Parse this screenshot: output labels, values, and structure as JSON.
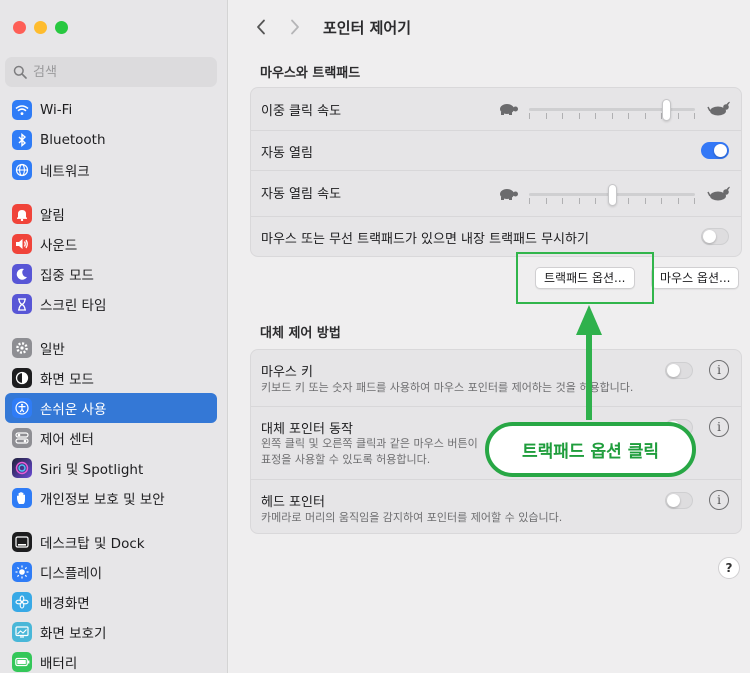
{
  "window": {
    "title": "포인터 제어기"
  },
  "sidebar": {
    "search_placeholder": "검색",
    "items": [
      {
        "label": "Wi-Fi",
        "icon": "wifi-icon",
        "color": "#2f7cf6"
      },
      {
        "label": "Bluetooth",
        "icon": "bluetooth-icon",
        "color": "#2f7cf6"
      },
      {
        "label": "네트워크",
        "icon": "globe-icon",
        "color": "#2f7cf6"
      },
      {
        "label": "알림",
        "icon": "bell-icon",
        "color": "#f0443a"
      },
      {
        "label": "사운드",
        "icon": "speaker-icon",
        "color": "#f0443a"
      },
      {
        "label": "집중 모드",
        "icon": "moon-icon",
        "color": "#5856d6"
      },
      {
        "label": "스크린 타임",
        "icon": "hourglass-icon",
        "color": "#5856d6"
      },
      {
        "label": "일반",
        "icon": "gear-icon",
        "color": "#8e8e93"
      },
      {
        "label": "화면 모드",
        "icon": "appearance-icon",
        "color": "#1d1d1f"
      },
      {
        "label": "손쉬운 사용",
        "icon": "accessibility-icon",
        "color": "#2f7cf6"
      },
      {
        "label": "제어 센터",
        "icon": "control-center-icon",
        "color": "#8e8e93"
      },
      {
        "label": "Siri 및 Spotlight",
        "icon": "siri-icon",
        "color": "#6b4bd6"
      },
      {
        "label": "개인정보 보호 및 보안",
        "icon": "hand-icon",
        "color": "#2f7cf6"
      },
      {
        "label": "데스크탑 및 Dock",
        "icon": "dock-icon",
        "color": "#1d1d1f"
      },
      {
        "label": "디스플레이",
        "icon": "sun-icon",
        "color": "#2f7cf6"
      },
      {
        "label": "배경화면",
        "icon": "flower-icon",
        "color": "#38a9e6"
      },
      {
        "label": "화면 보호기",
        "icon": "screensaver-icon",
        "color": "#49b7d8"
      },
      {
        "label": "배터리",
        "icon": "battery-icon",
        "color": "#34c759"
      }
    ],
    "active_index": 9
  },
  "mouse_trackpad": {
    "section_title": "마우스와 트랙패드",
    "double_click_label": "이중 클릭 속도",
    "double_click_value": 0.85,
    "spring_loading_label": "자동 열림",
    "spring_loading_on": true,
    "spring_speed_label": "자동 열림 속도",
    "spring_speed_value": 0.5,
    "ignore_trackpad_label": "마우스 또는 무선 트랙패드가 있으면 내장 트랙패드 무시하기",
    "ignore_trackpad_on": false,
    "trackpad_options_label": "트랙패드 옵션...",
    "mouse_options_label": "마우스 옵션..."
  },
  "alt_control": {
    "section_title": "대체 제어 방법",
    "mouse_keys_label": "마우스 키",
    "mouse_keys_desc": "키보드 키 또는 숫자 패드를 사용하여 마우스 포인터를 제어하는 것을 허용합니다.",
    "alt_pointer_label": "대체 포인터 동작",
    "alt_pointer_desc_1": "왼쪽 클릭 및 오른쪽 클릭과 같은 마우스 버튼이",
    "alt_pointer_desc_2": "표정을 사용할 수 있도록 허용합니다.",
    "head_pointer_label": "헤드 포인터",
    "head_pointer_desc": "카메라로 머리의 움직임을 감지하여 포인터를 제어할 수 있습니다."
  },
  "help_label": "?",
  "annotation": {
    "callout_text": "트랙패드 옵션 클릭",
    "color": "#28a745"
  }
}
